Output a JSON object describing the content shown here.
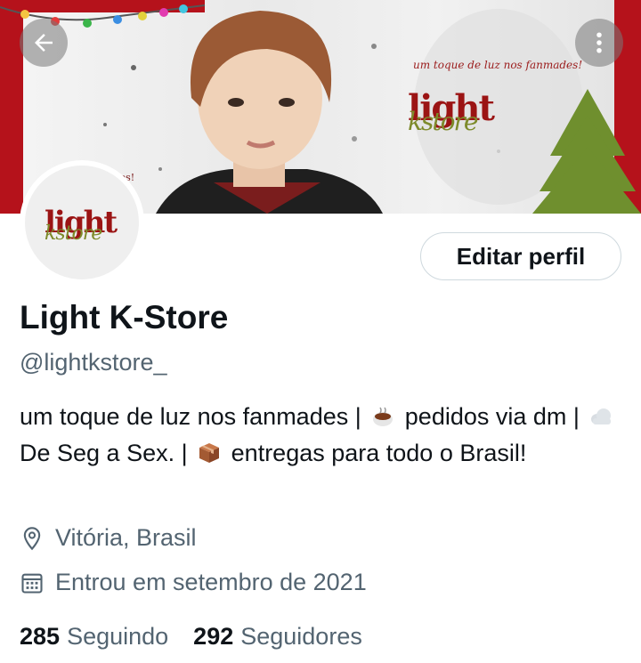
{
  "banner": {
    "tagline": "um toque de luz nos fanmades!",
    "logo_word1": "light",
    "logo_word2": "kstore",
    "side_text": "ões!",
    "colors": {
      "red": "#b5121b",
      "tree": "#6f8f2e"
    }
  },
  "nav": {
    "back_icon": "arrow-left-icon",
    "more_icon": "more-vertical-icon"
  },
  "avatar": {
    "logo_word1": "light",
    "logo_word2": "kstore"
  },
  "edit_button": {
    "label": "Editar perfil"
  },
  "profile": {
    "name": "Light K-Store",
    "handle": "@lightkstore_",
    "bio": {
      "part1": "um toque de luz nos fanmades |",
      "part2": "pedidos via dm |",
      "part3": "De Seg a Sex. |",
      "part4": "entregas para todo o Brasil!"
    },
    "location": "Vitória, Brasil",
    "joined": "Entrou em setembro de 2021"
  },
  "stats": {
    "following_count": "285",
    "following_label": "Seguindo",
    "followers_count": "292",
    "followers_label": "Seguidores"
  }
}
